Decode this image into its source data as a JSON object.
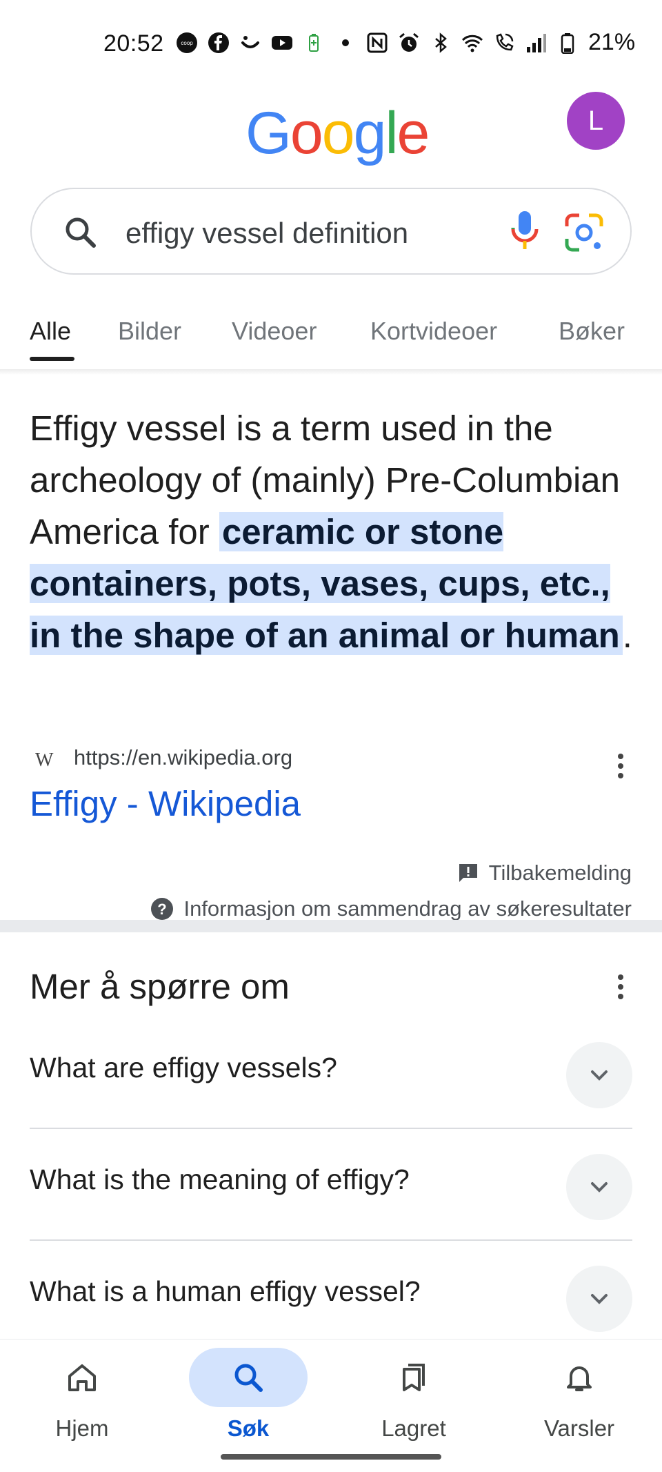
{
  "status_bar": {
    "time": "20:52",
    "battery": "21%",
    "icons": [
      "coop-icon",
      "facebook-icon",
      "smile-icon",
      "youtube-icon",
      "battery-saver-icon",
      "dot-icon",
      "nfc-icon",
      "alarm-icon",
      "bluetooth-icon",
      "wifi-icon",
      "wifi-call-icon",
      "signal-icon",
      "battery-icon"
    ],
    "coop_label": "coop"
  },
  "header": {
    "logo": "Google",
    "avatar_letter": "L",
    "avatar_color": "#a142c5"
  },
  "search": {
    "query": "effigy vessel definition"
  },
  "tabs": [
    "Alle",
    "Bilder",
    "Videoer",
    "Kortvideoer",
    "Bøker"
  ],
  "snippet": {
    "text_before": "Effigy vessel is a term used in the archeology of (mainly) Pre-Columbian America for ",
    "highlight": "ceramic or stone containers, pots, vases, cups, etc., in the shape of an animal or human",
    "text_after": "."
  },
  "source": {
    "favicon": "W",
    "url": "https://en.wikipedia.org",
    "title": "Effigy - Wikipedia"
  },
  "feedback_label": "Tilbakemelding",
  "info_label": "Informasjon om sammendrag av søkeresultater",
  "paa": {
    "title": "Mer å spørre om",
    "questions": [
      "What are effigy vessels?",
      "What is the meaning of effigy?",
      "What is a human effigy vessel?"
    ]
  },
  "bottom_nav": [
    {
      "label": "Hjem",
      "icon": "home-icon"
    },
    {
      "label": "Søk",
      "icon": "search-icon",
      "active": true
    },
    {
      "label": "Lagret",
      "icon": "bookmarks-icon"
    },
    {
      "label": "Varsler",
      "icon": "bell-icon"
    }
  ],
  "colors": {
    "link_blue": "#1558d6",
    "highlight": "#d3e3fd",
    "active_nav": "#0b57d0"
  }
}
